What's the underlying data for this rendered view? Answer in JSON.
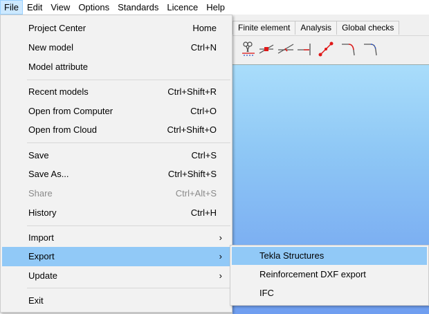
{
  "menubar": {
    "items": [
      "File",
      "Edit",
      "View",
      "Options",
      "Standards",
      "Licence",
      "Help"
    ]
  },
  "tabs": [
    "Finite element",
    "Analysis",
    "Global checks"
  ],
  "toolbar": {
    "icons": [
      "cut-icon",
      "node-icon",
      "line-icon",
      "line-end-icon",
      "diagonal-line-icon",
      "corner-icon",
      "corner-dashed-icon"
    ]
  },
  "colors": {
    "menu_highlight": "#91c9f7",
    "menubar_active": "#cce8ff",
    "canvas_top": "#a9ddfb",
    "canvas_bottom": "#6f9ef0"
  },
  "file_menu": {
    "items": [
      {
        "label": "Project Center",
        "shortcut": "Home"
      },
      {
        "label": "New model",
        "shortcut": "Ctrl+N"
      },
      {
        "label": "Model attribute",
        "shortcut": ""
      },
      {
        "label": "Recent models",
        "shortcut": "Ctrl+Shift+R"
      },
      {
        "label": "Open from Computer",
        "shortcut": "Ctrl+O"
      },
      {
        "label": "Open from Cloud",
        "shortcut": "Ctrl+Shift+O"
      },
      {
        "label": "Save",
        "shortcut": "Ctrl+S"
      },
      {
        "label": "Save As...",
        "shortcut": "Ctrl+Shift+S"
      },
      {
        "label": "Share",
        "shortcut": "Ctrl+Alt+S"
      },
      {
        "label": "History",
        "shortcut": "Ctrl+H"
      },
      {
        "label": "Import",
        "shortcut": ""
      },
      {
        "label": "Export",
        "shortcut": ""
      },
      {
        "label": "Update",
        "shortcut": ""
      },
      {
        "label": "Exit",
        "shortcut": ""
      }
    ],
    "submenu_arrow": "›"
  },
  "export_submenu": {
    "items": [
      "Tekla Structures",
      "Reinforcement DXF export",
      "IFC"
    ]
  }
}
